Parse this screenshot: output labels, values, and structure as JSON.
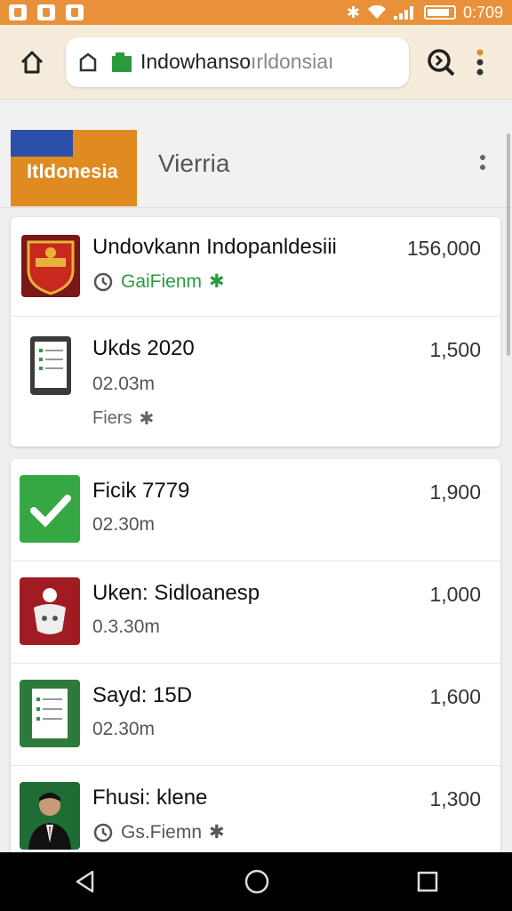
{
  "status_bar": {
    "time": "0:709"
  },
  "browser": {
    "url_main": "Indowhanso",
    "url_faded": "ırldonsiaı"
  },
  "tabs": {
    "active_label": "Itldonesia",
    "other_label": "Vierria"
  },
  "items": [
    {
      "title": "Undovkann Indopanldesiii",
      "sub": "GaiFienm",
      "price": "156,000"
    },
    {
      "title": "Ukds 2020",
      "sub": "02.03m",
      "sub2": "Fiers",
      "price": "1,500"
    },
    {
      "title": "Ficik 7779",
      "sub": "02.30m",
      "price": "1,900"
    },
    {
      "title": "Uken: Sidloanesp",
      "sub": "0.3.30m",
      "price": "1,000"
    },
    {
      "title": "Sayd: 15D",
      "sub": "02.30m",
      "price": "1,600"
    },
    {
      "title": "Fhusi: klene",
      "sub": "Gs.Fiemn",
      "price": "1,300"
    }
  ],
  "colors": {
    "status_bar": "#e8913a",
    "tab_active": "#e08a22",
    "tab_stripe": "#2c4fa8",
    "accent_green": "#2a9b3c"
  }
}
